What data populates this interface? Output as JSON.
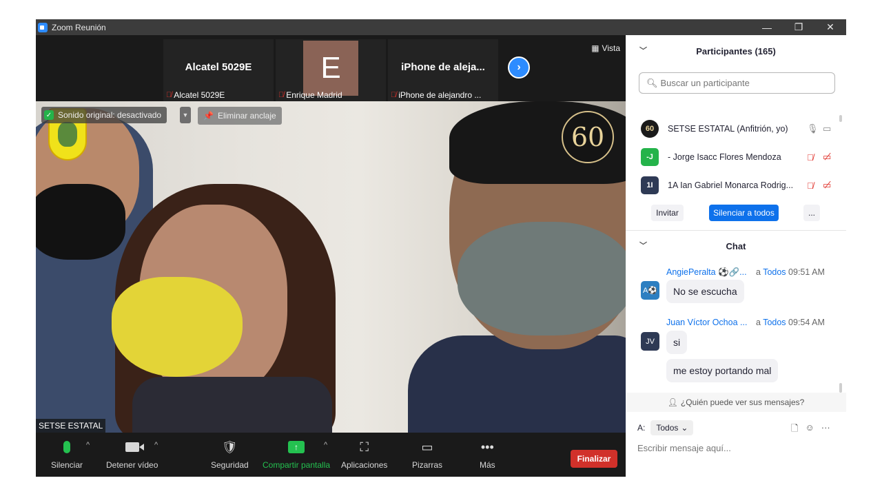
{
  "window": {
    "title": "Zoom Reunión",
    "controls": [
      "—",
      "❐",
      "✕"
    ]
  },
  "thumbnails": [
    {
      "big_name": "Alcatel 5029E",
      "caption": "Alcatel 5029E",
      "muted": true
    },
    {
      "avatar_letter": "E",
      "caption": "Enrique Madrid",
      "muted": true
    },
    {
      "big_name": "iPhone de aleja...",
      "caption": "iPhone de alejandro ...",
      "muted": true
    }
  ],
  "view_button": "Vista",
  "main_video": {
    "original_sound": "Sonido original: desactivado",
    "unpin": "Eliminar anclaje",
    "speaker": "SETSE ESTATAL",
    "badge_text": "60"
  },
  "toolbar": {
    "mute": "Silenciar",
    "stop_video": "Detener vídeo",
    "security": "Seguridad",
    "share": "Compartir pantalla",
    "apps": "Aplicaciones",
    "whiteboards": "Pizarras",
    "more": "Más",
    "end": "Finalizar"
  },
  "participants_panel": {
    "title": "Participantes (165)",
    "search_placeholder": "Buscar un participante",
    "list": [
      {
        "initials": "60",
        "name": "SETSE ESTATAL (Anfitrión, yo)",
        "color": "#1a1a1a",
        "muted": false
      },
      {
        "initials": "-J",
        "name": "- Jorge Isacc Flores Mendoza",
        "color": "#24b34a",
        "muted": true
      },
      {
        "initials": "1I",
        "name": "1A Ian Gabriel Monarca Rodrig...",
        "color": "#2e3a55",
        "muted": true
      }
    ],
    "invite": "Invitar",
    "mute_all": "Silenciar a todos",
    "more": "..."
  },
  "chat": {
    "title": "Chat",
    "messages": [
      {
        "sender": "AngiePeralta ⚽🔗...",
        "to_prefix": "a",
        "to": "Todos",
        "time": "09:51 AM",
        "initials": "A⚽",
        "avatar_color": "#2d7fc1",
        "texts": [
          "No se escucha"
        ]
      },
      {
        "sender": "Juan Víctor Ochoa ...",
        "to_prefix": "a",
        "to": "Todos",
        "time": "09:54 AM",
        "initials": "JV",
        "avatar_color": "#2e3a55",
        "texts": [
          "si",
          "me estoy portando mal"
        ]
      }
    ],
    "who_can_see": "¿Quién puede ver sus mensajes?",
    "to_label": "A:",
    "to_value": "Todos",
    "input_placeholder": "Escribir mensaje aquí..."
  }
}
